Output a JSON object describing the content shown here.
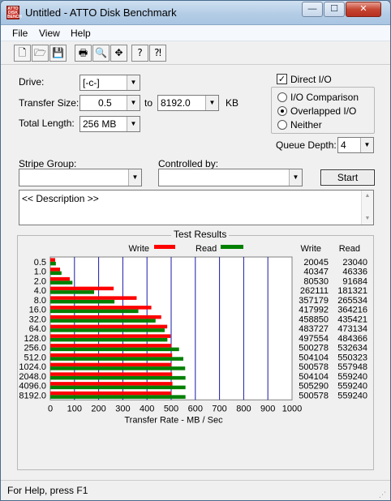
{
  "window": {
    "title": "Untitled - ATTO Disk Benchmark",
    "app_icon_text": "ATTO DISK BENCH",
    "controls": {
      "minimize": "—",
      "maximize": "☐",
      "close": "✕"
    }
  },
  "menu": [
    "File",
    "View",
    "Help"
  ],
  "toolbar": [
    {
      "name": "new-icon",
      "glyph": "🗋"
    },
    {
      "name": "open-icon",
      "glyph": "🗁"
    },
    {
      "name": "save-icon",
      "glyph": "💾"
    },
    {
      "name": "print-icon",
      "glyph": "🖶"
    },
    {
      "name": "print-preview-icon",
      "glyph": "🔍"
    },
    {
      "name": "move-icon",
      "glyph": "✥"
    },
    {
      "name": "help-icon",
      "glyph": "?"
    },
    {
      "name": "context-help-icon",
      "glyph": "⁈"
    }
  ],
  "settings": {
    "drive_label": "Drive:",
    "drive_value": "[-c-]",
    "transfer_size_label": "Transfer Size:",
    "transfer_from": "0.5",
    "transfer_to_label": "to",
    "transfer_to": "8192.0",
    "transfer_unit": "KB",
    "total_length_label": "Total Length:",
    "total_length": "256 MB",
    "direct_io_label": "Direct I/O",
    "direct_io_checked": true,
    "io_modes": [
      {
        "label": "I/O Comparison",
        "selected": false
      },
      {
        "label": "Overlapped I/O",
        "selected": true
      },
      {
        "label": "Neither",
        "selected": false
      }
    ],
    "queue_depth_label": "Queue Depth:",
    "queue_depth": "4",
    "stripe_group_label": "Stripe Group:",
    "stripe_group": "",
    "controlled_by_label": "Controlled by:",
    "controlled_by": "",
    "start_label": "Start",
    "description": "<< Description >>"
  },
  "results": {
    "title": "Test Results",
    "legend_write": "Write",
    "legend_read": "Read",
    "col_write": "Write",
    "col_read": "Read",
    "colors": {
      "write": "#ff0000",
      "read": "#008000",
      "grid": "#1a1aa8"
    }
  },
  "chart_data": {
    "type": "bar",
    "orientation": "horizontal",
    "title": "Test Results",
    "xlabel": "Transfer Rate - MB / Sec",
    "xlim": [
      0,
      1000
    ],
    "xticks": [
      0,
      100,
      200,
      300,
      400,
      500,
      600,
      700,
      800,
      900,
      1000
    ],
    "categories": [
      "0.5",
      "1.0",
      "2.0",
      "4.0",
      "8.0",
      "16.0",
      "32.0",
      "64.0",
      "128.0",
      "256.0",
      "512.0",
      "1024.0",
      "2048.0",
      "4096.0",
      "8192.0"
    ],
    "series": [
      {
        "name": "Write",
        "values": [
          20045,
          40347,
          80530,
          262111,
          357179,
          417992,
          458850,
          483727,
          497554,
          500278,
          504104,
          500578,
          504104,
          505290,
          500578
        ]
      },
      {
        "name": "Read",
        "values": [
          23040,
          46336,
          91684,
          181321,
          265534,
          364216,
          435421,
          473134,
          484366,
          532634,
          550323,
          557948,
          559240,
          559240,
          559240
        ]
      }
    ],
    "grid": true,
    "legend": "top"
  },
  "status": {
    "text": "For Help, press F1",
    "grip": "⋰"
  }
}
